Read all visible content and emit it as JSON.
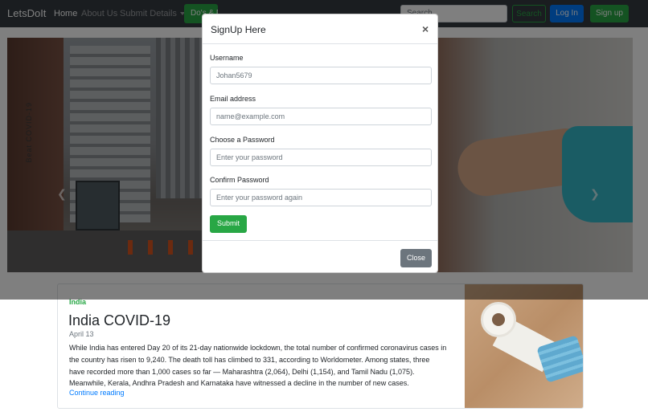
{
  "navbar": {
    "brand": "LetsDoIt",
    "links": [
      "Home",
      "About Us",
      "Submit Details"
    ],
    "dodont_label": "Do's & Don't",
    "search_placeholder": "Search",
    "search_button": "Search",
    "login_button": "Log In",
    "signup_button": "Sign up"
  },
  "carousel": {
    "vertical_text": "Beat COVID-19"
  },
  "card": {
    "category": "India",
    "title": "India COVID-19",
    "date": "April 13",
    "body": "While India has entered Day 20 of its 21-day nationwide lockdown, the total number of confirmed coronavirus cases in the country has risen to 9,240. The death toll has climbed to 331, according to Worldometer. Among states, three have recorded more than 1,000 cases so far — Maharashtra (2,064), Delhi (1,154), and Tamil Nadu (1,075). Meanwhile, Kerala, Andhra Pradesh and Karnataka have witnessed a decline in the number of new cases.",
    "link": "Continue reading"
  },
  "modal": {
    "title": "SignUp Here",
    "close_symbol": "×",
    "fields": [
      {
        "label": "Username",
        "value": "Johan5679"
      },
      {
        "label": "Email address",
        "value": "name@example.com"
      },
      {
        "label": "Choose a Password",
        "value": "Enter your password"
      },
      {
        "label": "Confirm Password",
        "value": "Enter your password again"
      }
    ],
    "submit_label": "Submit",
    "close_label": "Close"
  },
  "colors": {
    "navbar_bg": "#343a40",
    "success": "#28a745",
    "primary": "#007bff",
    "secondary": "#6c757d"
  }
}
